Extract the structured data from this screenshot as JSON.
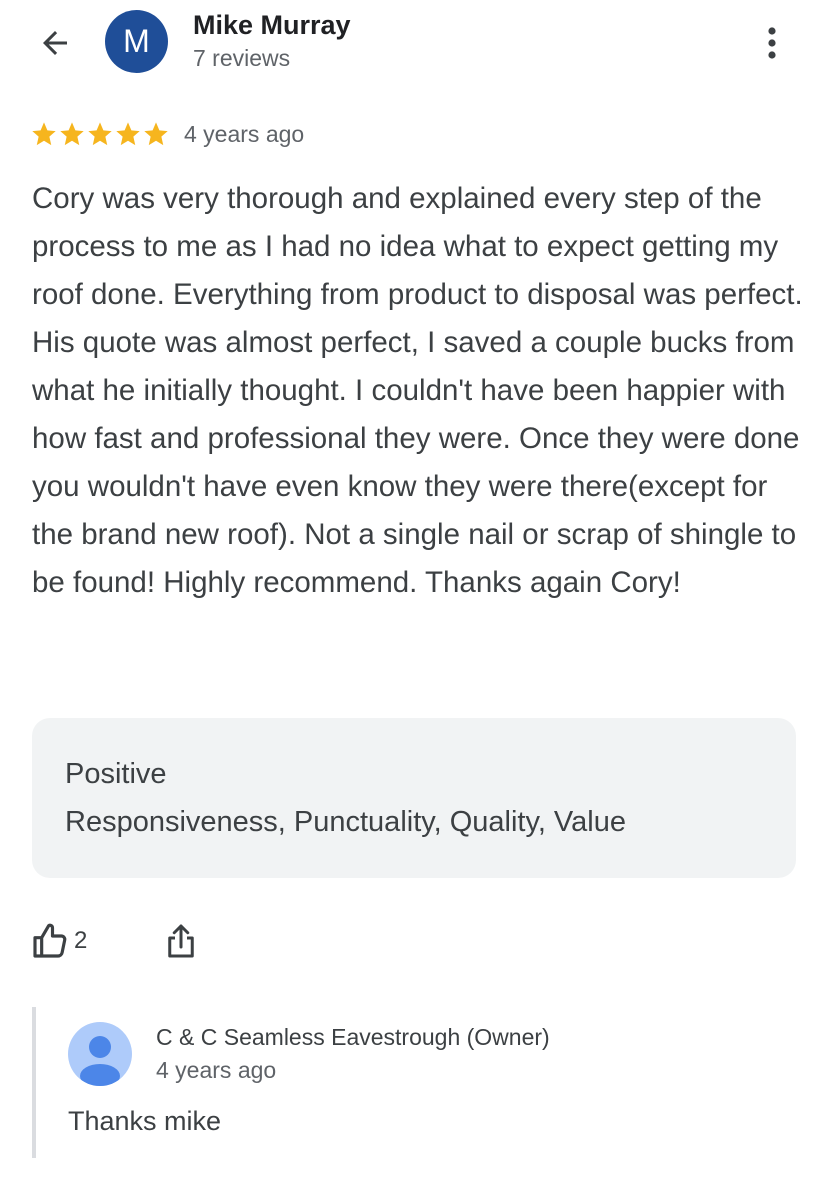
{
  "header": {
    "reviewer_name": "Mike Murray",
    "reviewer_initial": "M",
    "reviewer_reviews": "7 reviews",
    "avatar_color": "#1f4e98"
  },
  "review": {
    "rating": 5,
    "rating_max": 5,
    "star_color": "#f6b51e",
    "time": "4 years ago",
    "text": "Cory was very thorough and explained every step of the process to me as I had no idea what to expect getting my roof done. Everything from product to disposal was perfect. His quote was almost perfect, I saved a couple bucks from what he initially thought. I couldn't have been happier with how fast and professional they were. Once they were done you wouldn't have even know they were there(except for the brand new roof). Not a single nail or scrap of shingle to be found! Highly recommend. Thanks again Cory!"
  },
  "attributes": {
    "label": "Positive",
    "values": "Responsiveness, Punctuality, Quality, Value"
  },
  "actions": {
    "like_count": "2",
    "like_icon": "thumbs-up-icon",
    "share_icon": "share-icon"
  },
  "owner_reply": {
    "name": "C & C Seamless Eavestrough (Owner)",
    "time": "4 years ago",
    "text": "Thanks mike",
    "avatar_icon": "person-icon",
    "avatar_color": "#aecbfa"
  }
}
